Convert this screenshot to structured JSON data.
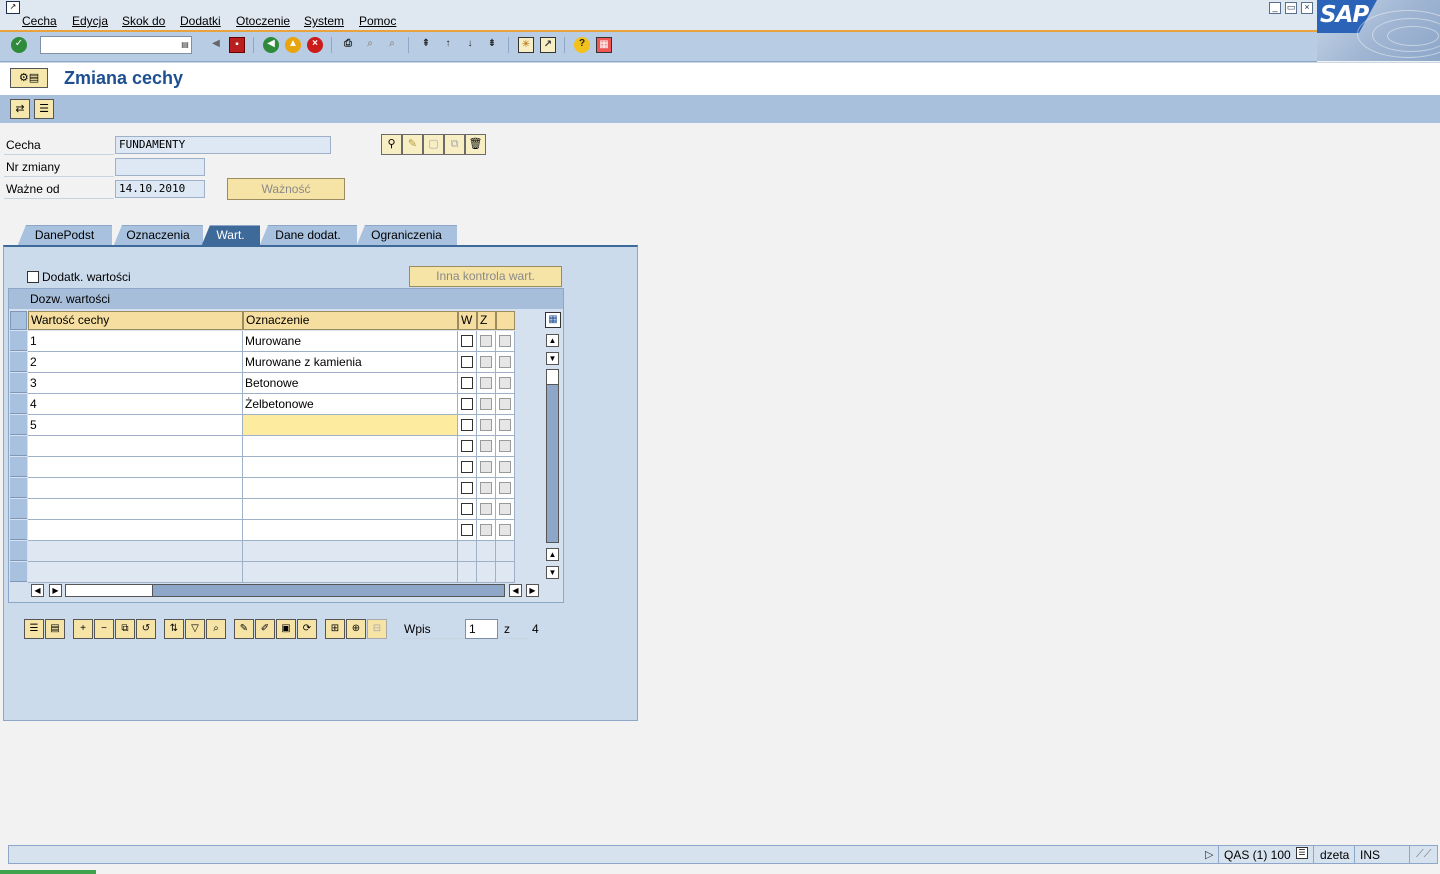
{
  "menu": {
    "items": [
      "Cecha",
      "Edycja",
      "Skok do",
      "Dodatki",
      "Otoczenie",
      "System",
      "Pomoc"
    ]
  },
  "window_controls": [
    "minimize",
    "maximize",
    "close"
  ],
  "logo": "SAP",
  "command_field": {
    "value": ""
  },
  "title": "Zmiana cechy",
  "header": {
    "cecha_label": "Cecha",
    "cecha_value": "FUNDAMENTY",
    "nr_zmiany_label": "Nr zmiany",
    "nr_zmiany_value": "",
    "wazne_od_label": "Ważne od",
    "wazne_od_value": "14.10.2010",
    "waznosc_button": "Ważność"
  },
  "tabs": [
    {
      "label": "DanePodst",
      "active": false
    },
    {
      "label": "Oznaczenia",
      "active": false
    },
    {
      "label": "Wart.",
      "active": true
    },
    {
      "label": "Dane dodat.",
      "active": false
    },
    {
      "label": "Ograniczenia",
      "active": false
    }
  ],
  "values_tab": {
    "additional_values_label": "Dodatk. wartości",
    "additional_values_checked": false,
    "other_check_button": "Inna kontrola wart.",
    "table_title": "Dozw. wartości",
    "columns": [
      "Wartość cechy",
      "Oznaczenie",
      "W",
      "Z",
      ""
    ],
    "rows": [
      {
        "value": "1",
        "desc": "Murowane"
      },
      {
        "value": "2",
        "desc": "Murowane z kamienia"
      },
      {
        "value": "3",
        "desc": "Betonowe"
      },
      {
        "value": "4",
        "desc": "Żelbetonowe"
      },
      {
        "value": "5",
        "desc": ""
      },
      {
        "value": "",
        "desc": ""
      },
      {
        "value": "",
        "desc": ""
      },
      {
        "value": "",
        "desc": ""
      },
      {
        "value": "",
        "desc": ""
      },
      {
        "value": "",
        "desc": ""
      },
      {
        "value": "",
        "desc": ""
      },
      {
        "value": "",
        "desc": ""
      }
    ],
    "entry_label": "Wpis",
    "entry_value": "1",
    "of_label": "z",
    "total": "4"
  },
  "status": {
    "system": "QAS (1) 100",
    "user": "dzeta",
    "mode": "INS"
  },
  "colors": {
    "accent": "#1d4f91",
    "toolbar": "#b8cde4",
    "button": "#f6e3a6",
    "active_tab": "#3e6a9a",
    "focus_cell": "#fdeba0"
  }
}
